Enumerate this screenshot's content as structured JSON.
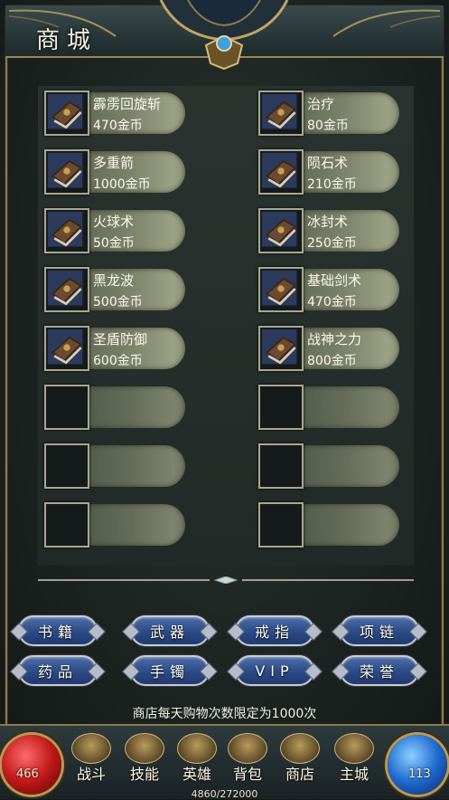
{
  "title": "商城",
  "items": [
    {
      "name": "霹雳回旋斩",
      "price": "470金币",
      "filled": true
    },
    {
      "name": "治疗",
      "price": "80金币",
      "filled": true
    },
    {
      "name": "多重箭",
      "price": "1000金币",
      "filled": true
    },
    {
      "name": "陨石术",
      "price": "210金币",
      "filled": true
    },
    {
      "name": "火球术",
      "price": "50金币",
      "filled": true
    },
    {
      "name": "冰封术",
      "price": "250金币",
      "filled": true
    },
    {
      "name": "黑龙波",
      "price": "500金币",
      "filled": true
    },
    {
      "name": "基础剑术",
      "price": "470金币",
      "filled": true
    },
    {
      "name": "圣盾防御",
      "price": "600金币",
      "filled": true
    },
    {
      "name": "战神之力",
      "price": "800金币",
      "filled": true
    },
    {
      "name": "",
      "price": "",
      "filled": false
    },
    {
      "name": "",
      "price": "",
      "filled": false
    },
    {
      "name": "",
      "price": "",
      "filled": false
    },
    {
      "name": "",
      "price": "",
      "filled": false
    },
    {
      "name": "",
      "price": "",
      "filled": false
    },
    {
      "name": "",
      "price": "",
      "filled": false
    }
  ],
  "categories": [
    "书籍",
    "武器",
    "戒指",
    "项链",
    "药品",
    "手镯",
    "VIP",
    "荣誉"
  ],
  "notice": "商店每天购物次数限定为1000次",
  "hp": "466",
  "mp": "113",
  "exp": "4860/272000",
  "nav": [
    {
      "label": "战斗",
      "icon": "swords-icon"
    },
    {
      "label": "技能",
      "icon": "skill-book-icon"
    },
    {
      "label": "英雄",
      "icon": "hero-helmet-icon"
    },
    {
      "label": "背包",
      "icon": "backpack-icon"
    },
    {
      "label": "商店",
      "icon": "shop-icon"
    },
    {
      "label": "主城",
      "icon": "castle-icon"
    }
  ],
  "colors": {
    "gold": "#b89a58",
    "button_blue": "#2b4a86",
    "item_bar": "#7b836a"
  }
}
